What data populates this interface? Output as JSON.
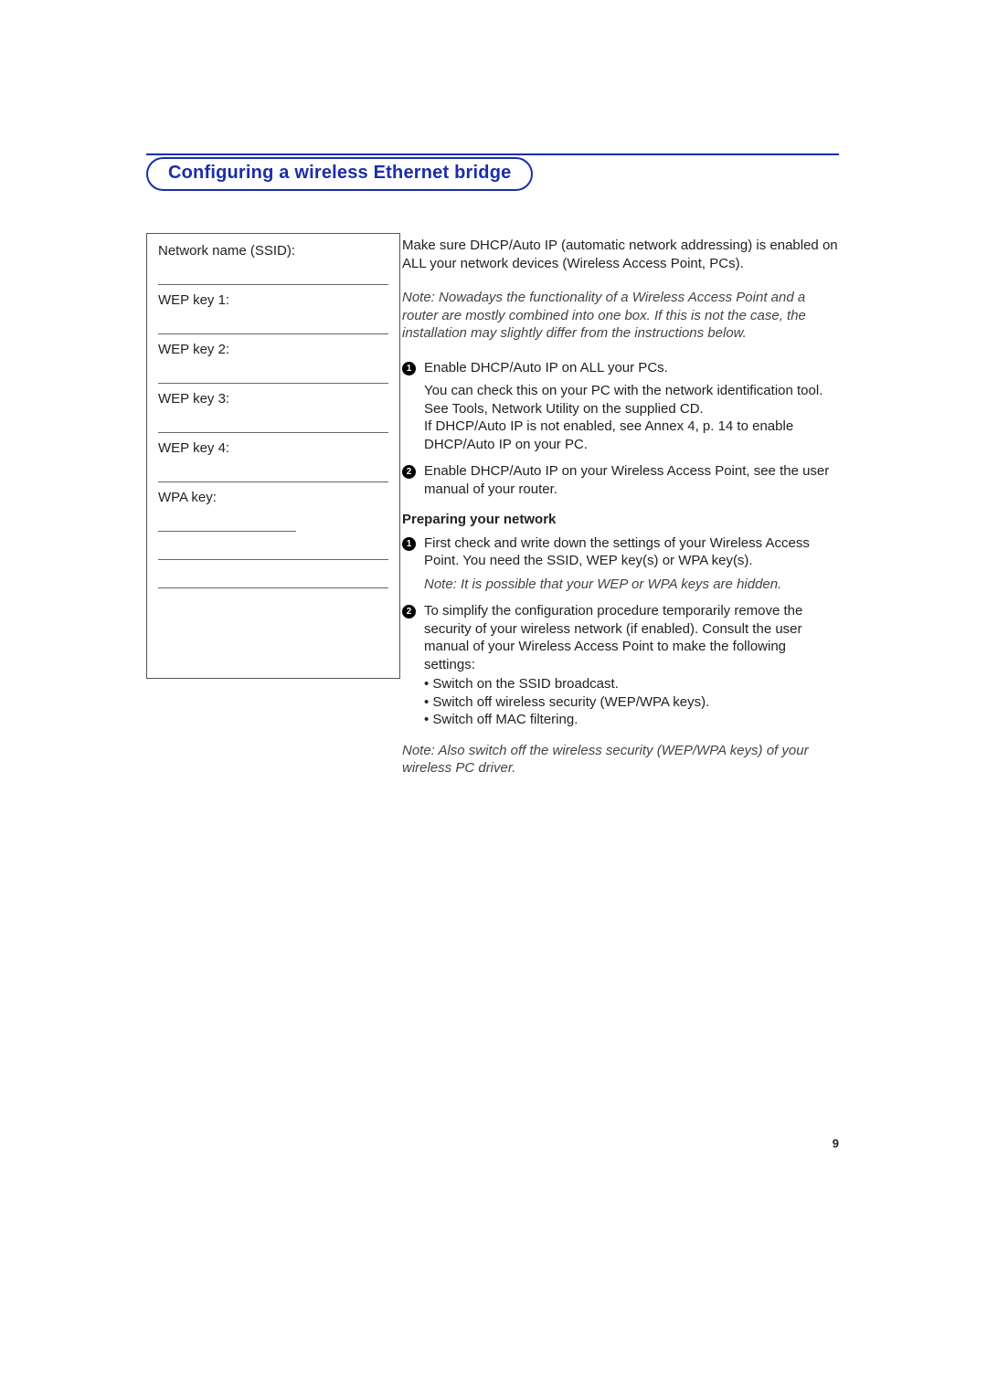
{
  "heading": "Configuring a wireless Ethernet bridge",
  "form": {
    "ssid_label": "Network name (SSID):",
    "wep1_label": "WEP key 1:",
    "wep2_label": "WEP key 2:",
    "wep3_label": "WEP key 3:",
    "wep4_label": "WEP key 4:",
    "wpa_label": "WPA key:"
  },
  "intro": "Make sure DHCP/Auto IP (automatic network addressing) is enabled on ALL your network devices (Wireless Access Point, PCs).",
  "note1": "Note: Nowadays the functionality of a Wireless Access Point and a router are mostly combined into one box. If this is not the case, the installation may slightly differ from the instructions below.",
  "steps_a": [
    {
      "num": "1",
      "text": "Enable DHCP/Auto IP on ALL your PCs.",
      "sub": "You can check this on your PC with the network identification tool. See Tools, Network Utility on the supplied CD.\nIf DHCP/Auto IP is not enabled, see Annex 4, p. 14 to enable DHCP/Auto IP on your PC."
    },
    {
      "num": "2",
      "text": "Enable DHCP/Auto IP on your Wireless Access Point, see the user manual of your router."
    }
  ],
  "prep_heading": "Preparing your network",
  "steps_b": [
    {
      "num": "1",
      "text": "First check and write down the settings of your Wireless Access Point. You need the SSID, WEP key(s) or WPA key(s).",
      "note": "Note: It is possible that your WEP or WPA keys are hidden."
    },
    {
      "num": "2",
      "text": "To simplify the configuration procedure temporarily remove the security of your wireless network (if enabled). Consult the user manual of your Wireless Access Point to make the following settings:",
      "bullets": [
        "Switch on the SSID broadcast.",
        "Switch off wireless security (WEP/WPA keys).",
        "Switch off MAC filtering."
      ]
    }
  ],
  "note2": "Note: Also switch off the wireless security (WEP/WPA keys) of your wireless PC driver.",
  "page_number": "9"
}
